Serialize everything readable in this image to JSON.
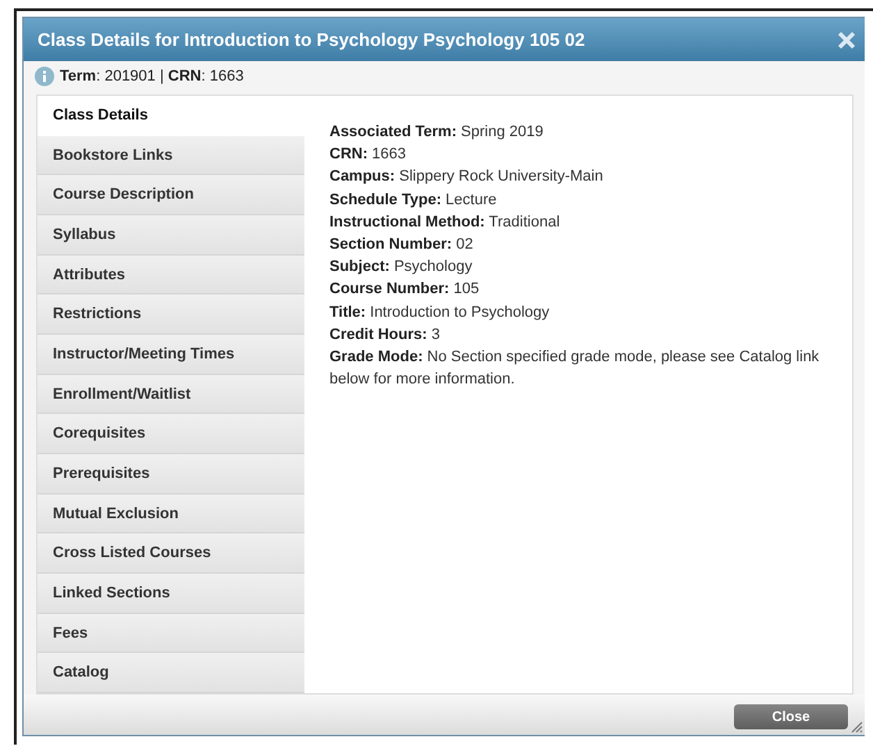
{
  "window": {
    "title": "Class Details for Introduction to Psychology Psychology 105 02"
  },
  "info": "**Term**: 201901 | **CRN**: 1663",
  "tabs": [
    {
      "label": "Class Details",
      "selected": true
    },
    {
      "label": "Bookstore Links",
      "selected": false
    },
    {
      "label": "Course Description",
      "selected": false
    },
    {
      "label": "Syllabus",
      "selected": false
    },
    {
      "label": "Attributes",
      "selected": false
    },
    {
      "label": "Restrictions",
      "selected": false
    },
    {
      "label": "Instructor/Meeting Times",
      "selected": false
    },
    {
      "label": "Enrollment/Waitlist",
      "selected": false
    },
    {
      "label": "Corequisites",
      "selected": false
    },
    {
      "label": "Prerequisites",
      "selected": false
    },
    {
      "label": "Mutual Exclusion",
      "selected": false
    },
    {
      "label": "Cross Listed Courses",
      "selected": false
    },
    {
      "label": "Linked Sections",
      "selected": false
    },
    {
      "label": "Fees",
      "selected": false
    },
    {
      "label": "Catalog",
      "selected": false
    }
  ],
  "details": [
    {
      "label": "Associated Term:",
      "value": "Spring 2019"
    },
    {
      "label": "CRN:",
      "value": "1663"
    },
    {
      "label": "Campus:",
      "value": "Slippery Rock University-Main"
    },
    {
      "label": "Schedule Type:",
      "value": "Lecture"
    },
    {
      "label": "Instructional Method:",
      "value": "Traditional"
    },
    {
      "label": "Section Number:",
      "value": "02"
    },
    {
      "label": "Subject:",
      "value": "Psychology"
    },
    {
      "label": "Course Number:",
      "value": "105"
    },
    {
      "label": "Title:",
      "value": "Introduction to Psychology"
    },
    {
      "label": "Credit Hours:",
      "value": "3"
    },
    {
      "label": "Grade Mode:",
      "value": "No Section specified grade mode, please see Catalog link below for more information."
    }
  ],
  "buttons": [
    "Close"
  ]
}
